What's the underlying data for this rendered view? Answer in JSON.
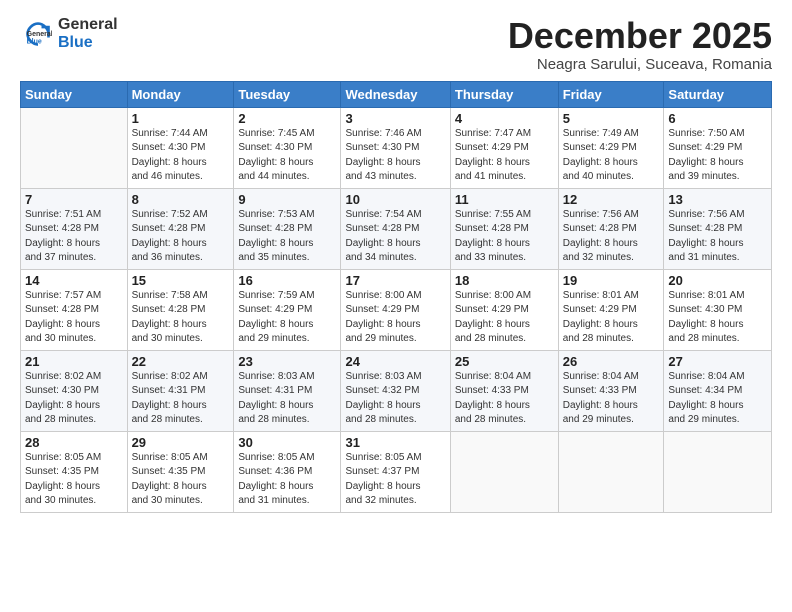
{
  "logo": {
    "general": "General",
    "blue": "Blue"
  },
  "header": {
    "month": "December 2025",
    "location": "Neagra Sarului, Suceava, Romania"
  },
  "weekdays": [
    "Sunday",
    "Monday",
    "Tuesday",
    "Wednesday",
    "Thursday",
    "Friday",
    "Saturday"
  ],
  "weeks": [
    [
      {
        "day": "",
        "info": ""
      },
      {
        "day": "1",
        "info": "Sunrise: 7:44 AM\nSunset: 4:30 PM\nDaylight: 8 hours\nand 46 minutes."
      },
      {
        "day": "2",
        "info": "Sunrise: 7:45 AM\nSunset: 4:30 PM\nDaylight: 8 hours\nand 44 minutes."
      },
      {
        "day": "3",
        "info": "Sunrise: 7:46 AM\nSunset: 4:30 PM\nDaylight: 8 hours\nand 43 minutes."
      },
      {
        "day": "4",
        "info": "Sunrise: 7:47 AM\nSunset: 4:29 PM\nDaylight: 8 hours\nand 41 minutes."
      },
      {
        "day": "5",
        "info": "Sunrise: 7:49 AM\nSunset: 4:29 PM\nDaylight: 8 hours\nand 40 minutes."
      },
      {
        "day": "6",
        "info": "Sunrise: 7:50 AM\nSunset: 4:29 PM\nDaylight: 8 hours\nand 39 minutes."
      }
    ],
    [
      {
        "day": "7",
        "info": "Sunrise: 7:51 AM\nSunset: 4:28 PM\nDaylight: 8 hours\nand 37 minutes."
      },
      {
        "day": "8",
        "info": "Sunrise: 7:52 AM\nSunset: 4:28 PM\nDaylight: 8 hours\nand 36 minutes."
      },
      {
        "day": "9",
        "info": "Sunrise: 7:53 AM\nSunset: 4:28 PM\nDaylight: 8 hours\nand 35 minutes."
      },
      {
        "day": "10",
        "info": "Sunrise: 7:54 AM\nSunset: 4:28 PM\nDaylight: 8 hours\nand 34 minutes."
      },
      {
        "day": "11",
        "info": "Sunrise: 7:55 AM\nSunset: 4:28 PM\nDaylight: 8 hours\nand 33 minutes."
      },
      {
        "day": "12",
        "info": "Sunrise: 7:56 AM\nSunset: 4:28 PM\nDaylight: 8 hours\nand 32 minutes."
      },
      {
        "day": "13",
        "info": "Sunrise: 7:56 AM\nSunset: 4:28 PM\nDaylight: 8 hours\nand 31 minutes."
      }
    ],
    [
      {
        "day": "14",
        "info": "Sunrise: 7:57 AM\nSunset: 4:28 PM\nDaylight: 8 hours\nand 30 minutes."
      },
      {
        "day": "15",
        "info": "Sunrise: 7:58 AM\nSunset: 4:28 PM\nDaylight: 8 hours\nand 30 minutes."
      },
      {
        "day": "16",
        "info": "Sunrise: 7:59 AM\nSunset: 4:29 PM\nDaylight: 8 hours\nand 29 minutes."
      },
      {
        "day": "17",
        "info": "Sunrise: 8:00 AM\nSunset: 4:29 PM\nDaylight: 8 hours\nand 29 minutes."
      },
      {
        "day": "18",
        "info": "Sunrise: 8:00 AM\nSunset: 4:29 PM\nDaylight: 8 hours\nand 28 minutes."
      },
      {
        "day": "19",
        "info": "Sunrise: 8:01 AM\nSunset: 4:29 PM\nDaylight: 8 hours\nand 28 minutes."
      },
      {
        "day": "20",
        "info": "Sunrise: 8:01 AM\nSunset: 4:30 PM\nDaylight: 8 hours\nand 28 minutes."
      }
    ],
    [
      {
        "day": "21",
        "info": "Sunrise: 8:02 AM\nSunset: 4:30 PM\nDaylight: 8 hours\nand 28 minutes."
      },
      {
        "day": "22",
        "info": "Sunrise: 8:02 AM\nSunset: 4:31 PM\nDaylight: 8 hours\nand 28 minutes."
      },
      {
        "day": "23",
        "info": "Sunrise: 8:03 AM\nSunset: 4:31 PM\nDaylight: 8 hours\nand 28 minutes."
      },
      {
        "day": "24",
        "info": "Sunrise: 8:03 AM\nSunset: 4:32 PM\nDaylight: 8 hours\nand 28 minutes."
      },
      {
        "day": "25",
        "info": "Sunrise: 8:04 AM\nSunset: 4:33 PM\nDaylight: 8 hours\nand 28 minutes."
      },
      {
        "day": "26",
        "info": "Sunrise: 8:04 AM\nSunset: 4:33 PM\nDaylight: 8 hours\nand 29 minutes."
      },
      {
        "day": "27",
        "info": "Sunrise: 8:04 AM\nSunset: 4:34 PM\nDaylight: 8 hours\nand 29 minutes."
      }
    ],
    [
      {
        "day": "28",
        "info": "Sunrise: 8:05 AM\nSunset: 4:35 PM\nDaylight: 8 hours\nand 30 minutes."
      },
      {
        "day": "29",
        "info": "Sunrise: 8:05 AM\nSunset: 4:35 PM\nDaylight: 8 hours\nand 30 minutes."
      },
      {
        "day": "30",
        "info": "Sunrise: 8:05 AM\nSunset: 4:36 PM\nDaylight: 8 hours\nand 31 minutes."
      },
      {
        "day": "31",
        "info": "Sunrise: 8:05 AM\nSunset: 4:37 PM\nDaylight: 8 hours\nand 32 minutes."
      },
      {
        "day": "",
        "info": ""
      },
      {
        "day": "",
        "info": ""
      },
      {
        "day": "",
        "info": ""
      }
    ]
  ]
}
